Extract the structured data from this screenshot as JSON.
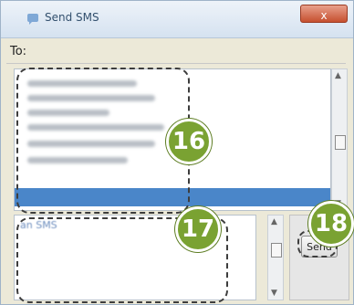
{
  "window": {
    "title": "Send SMS",
    "close_label": "x"
  },
  "to_label": "To:",
  "message_text": "an SMS",
  "send_label": "Send",
  "callouts": {
    "recipients": "16",
    "message": "17",
    "send": "18"
  },
  "colors": {
    "badge": "#7aa232",
    "selection": "#4a86c9"
  }
}
